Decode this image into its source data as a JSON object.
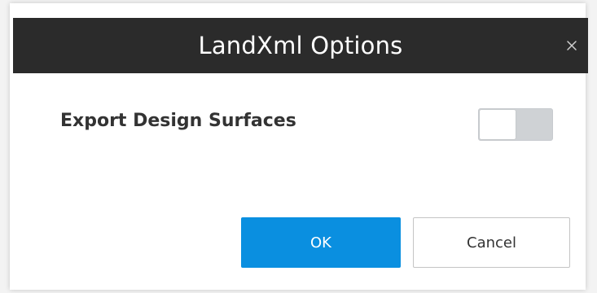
{
  "dialog": {
    "title": "LandXml Options",
    "close_icon": "close-icon",
    "setting": {
      "label": "Export Design Surfaces",
      "toggle_on": false
    },
    "buttons": {
      "ok_label": "OK",
      "cancel_label": "Cancel"
    }
  },
  "colors": {
    "titlebar": "#2b2b2b",
    "primary": "#0a8fe0",
    "toggle_off": "#cfd2d5"
  }
}
